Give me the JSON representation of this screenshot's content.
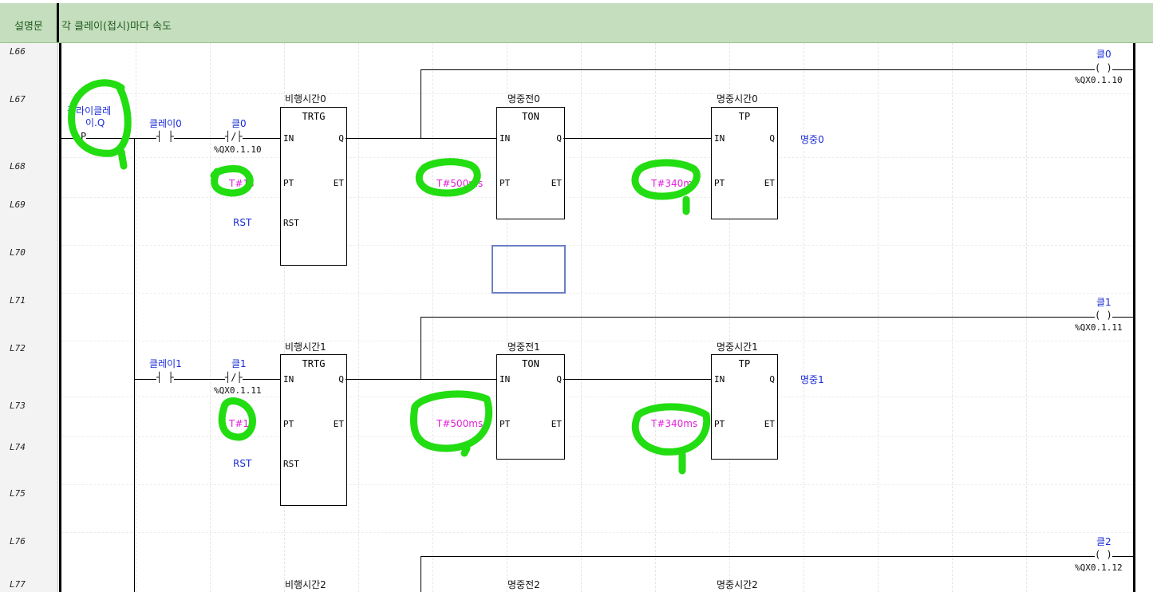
{
  "comment": {
    "label": "설명문",
    "text": "각 클레이(접시)마다 속도"
  },
  "rows": [
    "L66",
    "L67",
    "L68",
    "L69",
    "L70",
    "L71",
    "L72",
    "L73",
    "L74",
    "L75",
    "L76",
    "L77"
  ],
  "contacts": {
    "start_name": "플라이클레이.Q",
    "start_line1": "플라이클레",
    "start_line2": "이.Q",
    "start_symbol": "P",
    "clay0": "클레이0",
    "clay1": "클레이1"
  },
  "rung0": {
    "nc_name": "클0",
    "nc_addr": "%QX0.1.10",
    "trtg_inst": "비행시간0",
    "trtg_type": "TRTG",
    "pt_value": "T#1s",
    "rst": "RST",
    "ton_inst": "명중전0",
    "ton_type": "TON",
    "ton_pt": "T#500ms",
    "tp_inst": "명중시간0",
    "tp_type": "TP",
    "tp_pt": "T#340ms",
    "out_var": "명중0",
    "coil_name": "클0",
    "coil_addr": "%QX0.1.10"
  },
  "rung1": {
    "nc_name": "클1",
    "nc_addr": "%QX0.1.11",
    "trtg_inst": "비행시간1",
    "trtg_type": "TRTG",
    "pt_value": "T#1s",
    "rst": "RST",
    "ton_inst": "명중전1",
    "ton_type": "TON",
    "ton_pt": "T#500ms",
    "tp_inst": "명중시간1",
    "tp_type": "TP",
    "tp_pt": "T#340ms",
    "out_var": "명중1",
    "coil_name": "클1",
    "coil_addr": "%QX0.1.11"
  },
  "rung2": {
    "trtg_inst": "비행시간2",
    "ton_inst": "명중전2",
    "tp_inst": "명중시간2",
    "coil_name": "클2",
    "coil_addr": "%QX0.1.12"
  },
  "pins": {
    "in": "IN",
    "q": "Q",
    "pt": "PT",
    "et": "ET",
    "rst": "RST"
  },
  "symbols": {
    "no_contact": "┤ ├",
    "nc_contact": "┤/├",
    "coil": "( )"
  },
  "colors": {
    "comment_bg": "#c5dfbe",
    "variable": "#1a2bd6",
    "constant": "#e020d8",
    "annotation": "#22dd11"
  }
}
